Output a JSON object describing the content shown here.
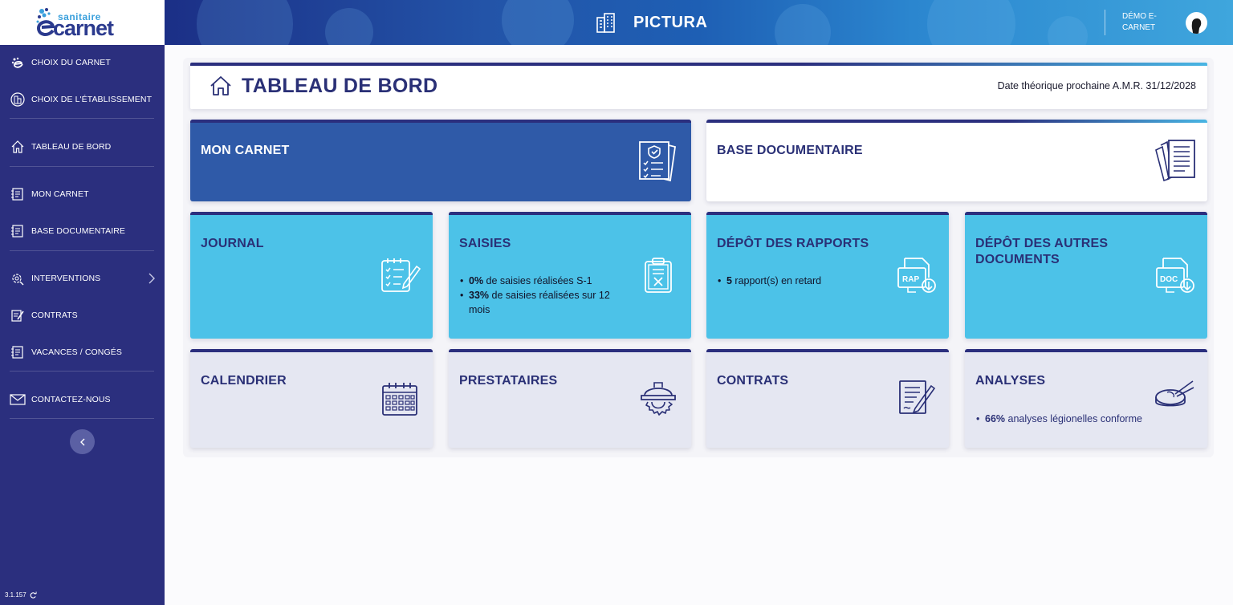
{
  "logo": {
    "top": "sanitaire",
    "bottom": "carnet"
  },
  "header": {
    "app_name": "PICTURA",
    "user_name": "DÉMO E-CARNET"
  },
  "sidebar": {
    "items": [
      {
        "label": "CHOIX DU CARNET",
        "icon": "carnet-logo-icon"
      },
      {
        "label": "CHOIX DE L'ÉTABLISSEMENT",
        "icon": "building-icon"
      },
      {
        "label": "TABLEAU DE BORD",
        "icon": "home-icon"
      },
      {
        "label": "MON CARNET",
        "icon": "notebook-icon"
      },
      {
        "label": "BASE DOCUMENTAIRE",
        "icon": "documents-icon"
      },
      {
        "label": "INTERVENTIONS",
        "icon": "tools-icon"
      },
      {
        "label": "CONTRATS",
        "icon": "contract-icon"
      },
      {
        "label": "VACANCES / CONGÉS",
        "icon": "calendar-icon"
      },
      {
        "label": "CONTACTEZ-NOUS",
        "icon": "mail-icon"
      }
    ],
    "version": "3.1.157"
  },
  "page": {
    "title": "TABLEAU DE BORD",
    "amr": "Date théorique prochaine A.M.R. 31/12/2028"
  },
  "tiles": {
    "mon_carnet": {
      "title": "MON CARNET"
    },
    "base_doc": {
      "title": "BASE DOCUMENTAIRE"
    },
    "journal": {
      "title": "JOURNAL"
    },
    "saisies": {
      "title": "SAISIES",
      "l1_value": "0%",
      "l1_text": " de saisies réalisées S-1",
      "l2_value": "33%",
      "l2_text": " de saisies réalisées sur 12 mois"
    },
    "depot_rapports": {
      "title": "DÉPÔT DES RAPPORTS",
      "l1_value": "5",
      "l1_text": " rapport(s) en retard",
      "icon_text": "RAP"
    },
    "depot_autres": {
      "title": "DÉPÔT DES AUTRES DOCUMENTS",
      "icon_text": "DOC"
    },
    "calendrier": {
      "title": "CALENDRIER"
    },
    "prestataires": {
      "title": "PRESTATAIRES"
    },
    "contrats": {
      "title": "CONTRATS"
    },
    "analyses": {
      "title": "ANALYSES",
      "l1_value": "66%",
      "l1_text": " analyses légionelles conforme"
    }
  }
}
